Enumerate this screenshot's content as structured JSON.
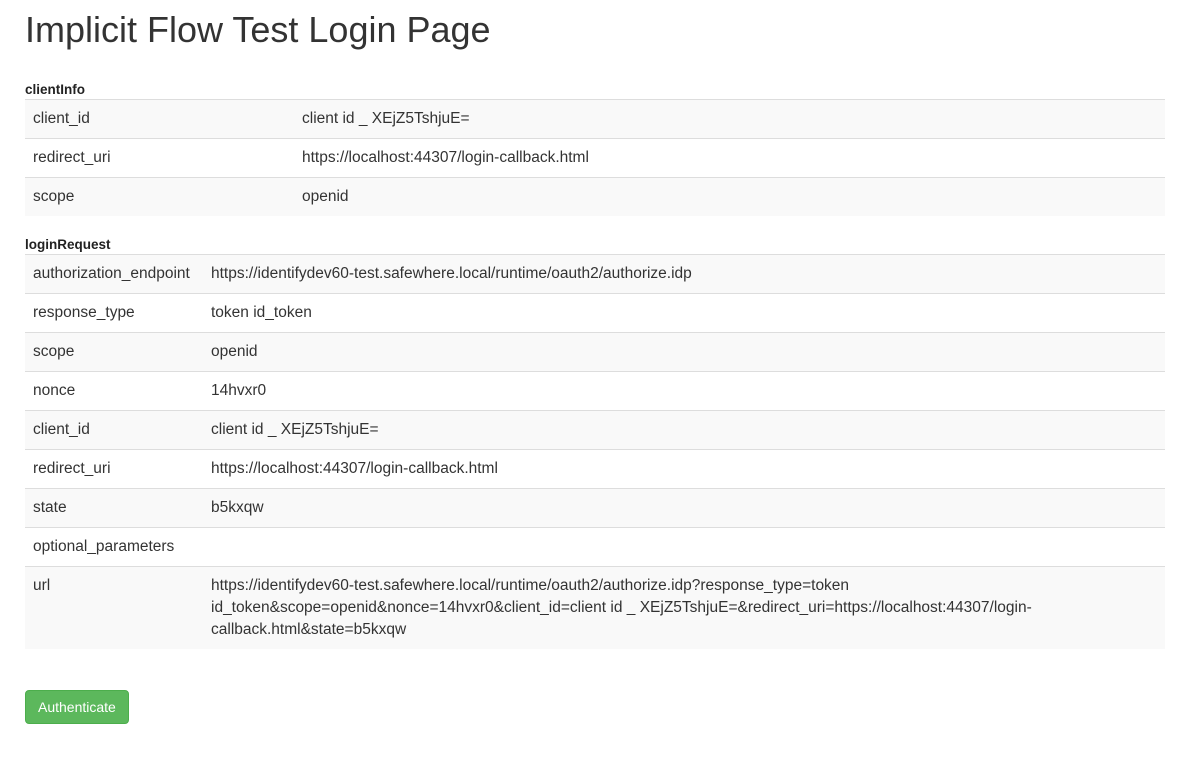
{
  "page_title": "Implicit Flow Test Login Page",
  "clientInfo": {
    "heading": "clientInfo",
    "rows": [
      {
        "key": "client_id",
        "value": "client id _ XEjZ5TshjuE="
      },
      {
        "key": "redirect_uri",
        "value": "https://localhost:44307/login-callback.html"
      },
      {
        "key": "scope",
        "value": "openid"
      }
    ]
  },
  "loginRequest": {
    "heading": "loginRequest",
    "rows": [
      {
        "key": "authorization_endpoint",
        "value": "https://identifydev60-test.safewhere.local/runtime/oauth2/authorize.idp"
      },
      {
        "key": "response_type",
        "value": "token id_token"
      },
      {
        "key": "scope",
        "value": "openid"
      },
      {
        "key": "nonce",
        "value": "14hvxr0"
      },
      {
        "key": "client_id",
        "value": "client id _ XEjZ5TshjuE="
      },
      {
        "key": "redirect_uri",
        "value": "https://localhost:44307/login-callback.html"
      },
      {
        "key": "state",
        "value": "b5kxqw"
      },
      {
        "key": "optional_parameters",
        "value": ""
      },
      {
        "key": "url",
        "value": "https://identifydev60-test.safewhere.local/runtime/oauth2/authorize.idp?response_type=token id_token&scope=openid&nonce=14hvxr0&client_id=client id _ XEjZ5TshjuE=&redirect_uri=https://localhost:44307/login-callback.html&state=b5kxqw"
      }
    ]
  },
  "actions": {
    "authenticate_label": "Authenticate"
  },
  "colors": {
    "button_bg": "#5cb85c",
    "stripe_bg": "#f9f9f9",
    "border": "#dddddd"
  }
}
